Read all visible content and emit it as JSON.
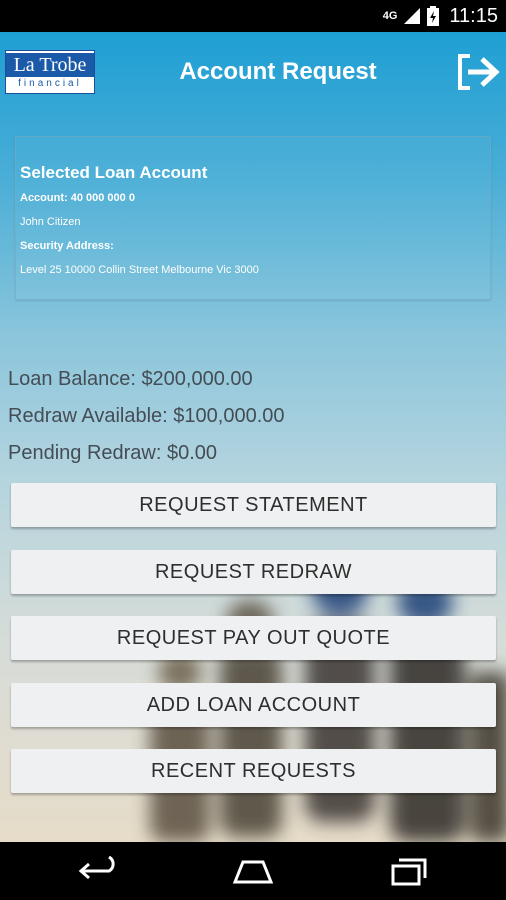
{
  "status_bar": {
    "network": "4G",
    "time": "11:15"
  },
  "header": {
    "logo_line1": "La Trobe",
    "logo_line2": "financial",
    "title": "Account Request",
    "logout_icon": "logout-arrow-icon"
  },
  "loan_card": {
    "heading": "Selected Loan Account",
    "account": "Account: 40 000 000 0",
    "name": "John Citizen",
    "security_heading": "Security Address:",
    "security_address": "Level 25 10000 Collin Street Melbourne Vic 3000"
  },
  "summary": {
    "loan_balance": "Loan Balance: $200,000.00",
    "redraw_available": "Redraw Available: $100,000.00",
    "pending_redraw": "Pending Redraw: $0.00"
  },
  "actions": {
    "request_statement": "REQUEST STATEMENT",
    "request_redraw": "REQUEST REDRAW",
    "request_payout_quote": "REQUEST PAY OUT QUOTE",
    "add_loan_account": "ADD LOAN ACCOUNT",
    "recent_requests": "RECENT REQUESTS"
  },
  "nav": {
    "back_icon": "back-icon",
    "home_icon": "home-icon",
    "recents_icon": "recents-icon"
  }
}
